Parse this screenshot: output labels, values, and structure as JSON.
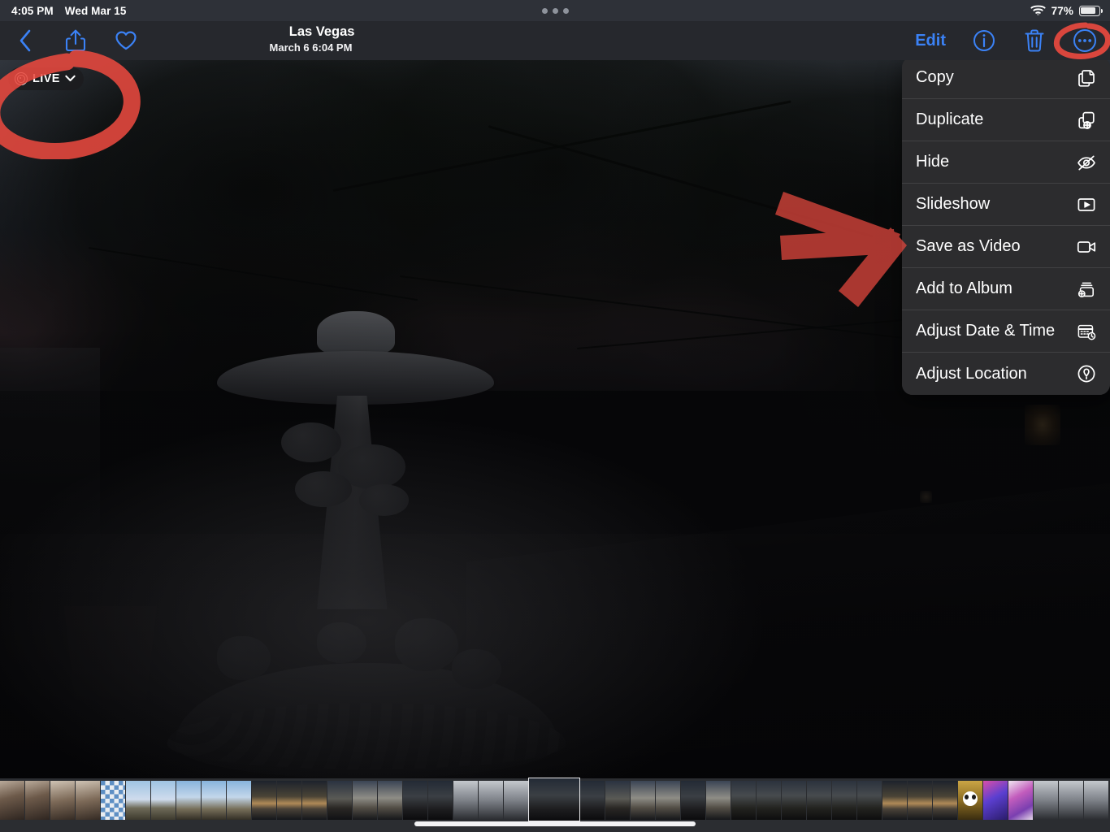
{
  "status_bar": {
    "time": "4:05 PM",
    "date": "Wed Mar 15",
    "battery_percent": "77%",
    "wifi_icon": "wifi-icon",
    "battery_icon": "battery-icon",
    "multitask_icon": "multitasking-dots-icon"
  },
  "nav_bar": {
    "back_icon": "back-chevron-icon",
    "share_icon": "share-icon",
    "favorite_icon": "heart-icon",
    "title": "Las Vegas",
    "subtitle": "March 6  6:04 PM",
    "edit_label": "Edit",
    "info_icon": "info-circle-icon",
    "delete_icon": "trash-icon",
    "more_icon": "more-ellipsis-circle-icon",
    "accent_color": "#3b82f6"
  },
  "live_badge": {
    "label": "LIVE",
    "live_icon": "live-photo-icon",
    "chevron_icon": "chevron-down-icon"
  },
  "context_menu": {
    "items": [
      {
        "label": "Copy",
        "icon": "copy-icon"
      },
      {
        "label": "Duplicate",
        "icon": "duplicate-icon"
      },
      {
        "label": "Hide",
        "icon": "eye-slash-icon"
      },
      {
        "label": "Slideshow",
        "icon": "play-rectangle-icon"
      },
      {
        "label": "Save as Video",
        "icon": "video-camera-icon"
      },
      {
        "label": "Add to Album",
        "icon": "add-to-album-icon"
      },
      {
        "label": "Adjust Date & Time",
        "icon": "calendar-clock-icon"
      },
      {
        "label": "Adjust Location",
        "icon": "location-pin-circle-icon"
      }
    ]
  },
  "annotations": {
    "color": "#e8493f",
    "circle_live_badge": "red-circle-annotation-live-badge",
    "circle_more_button": "red-circle-annotation-more-button",
    "arrow_to_menu": "red-arrow-annotation"
  },
  "photo": {
    "description": "Stone garden fountain at dusk with trees",
    "location": "Las Vegas",
    "captured": "March 6  6:04 PM"
  },
  "filmstrip": {
    "selected_index": 21,
    "thumbnails": [
      {
        "kind": "tb-room"
      },
      {
        "kind": "tb-room"
      },
      {
        "kind": "tb-room2"
      },
      {
        "kind": "tb-room2"
      },
      {
        "kind": "tb-chess"
      },
      {
        "kind": "tb-palm"
      },
      {
        "kind": "tb-palm"
      },
      {
        "kind": "tb-palm2"
      },
      {
        "kind": "tb-palm2"
      },
      {
        "kind": "tb-palm2"
      },
      {
        "kind": "tb-sunset"
      },
      {
        "kind": "tb-sunset"
      },
      {
        "kind": "tb-sunset"
      },
      {
        "kind": "tb-dusk"
      },
      {
        "kind": "tb-bld"
      },
      {
        "kind": "tb-bld"
      },
      {
        "kind": "tb-night"
      },
      {
        "kind": "tb-night"
      },
      {
        "kind": "tb-grey"
      },
      {
        "kind": "tb-grey"
      },
      {
        "kind": "tb-grey"
      },
      {
        "kind": "tb-night"
      },
      {
        "kind": "tb-night"
      },
      {
        "kind": "tb-dusk"
      },
      {
        "kind": "tb-bld"
      },
      {
        "kind": "tb-bld"
      },
      {
        "kind": "tb-night"
      },
      {
        "kind": "tb-bld"
      },
      {
        "kind": "tb-fount"
      },
      {
        "kind": "tb-fount"
      },
      {
        "kind": "tb-fount"
      },
      {
        "kind": "tb-fount"
      },
      {
        "kind": "tb-fount"
      },
      {
        "kind": "tb-fount"
      },
      {
        "kind": "tb-sunset"
      },
      {
        "kind": "tb-sunset"
      },
      {
        "kind": "tb-sunset"
      },
      {
        "kind": "tb-panda"
      },
      {
        "kind": "tb-art1"
      },
      {
        "kind": "tb-art2"
      },
      {
        "kind": "tb-grey"
      },
      {
        "kind": "tb-grey"
      },
      {
        "kind": "tb-grey"
      }
    ],
    "home_indicator": "home-indicator"
  }
}
